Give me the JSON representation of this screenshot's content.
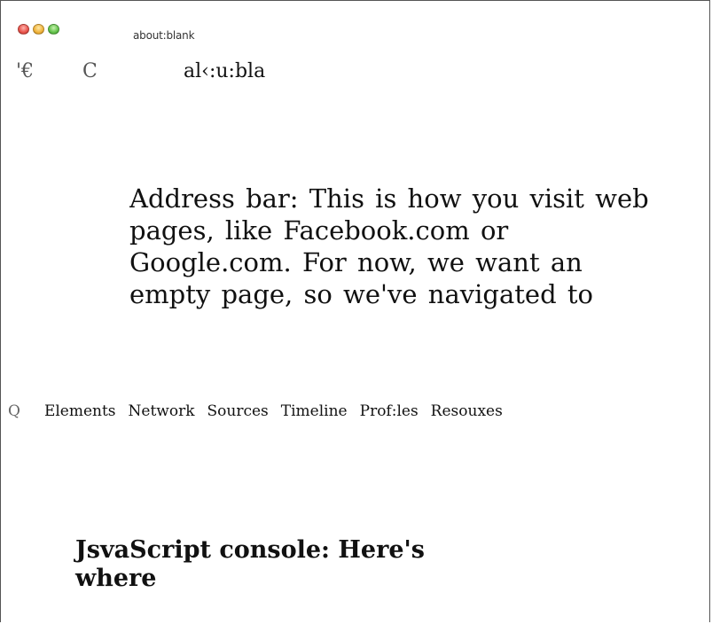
{
  "window": {
    "title": "about:blank"
  },
  "toolbar": {
    "back_glyph": "'€",
    "reload_glyph": "C",
    "address_text": "al‹:u:bla"
  },
  "annotation": {
    "address_bar_text": "Address  bar: This is how you visit web pages, like Facebook.com or Google.com. For now, we want  an empty  page,  so  we've  navigated to"
  },
  "devtools": {
    "search_glyph": "Q",
    "tabs": [
      {
        "label": "Elements"
      },
      {
        "label": "Network"
      },
      {
        "label": "Sources"
      },
      {
        "label": "Timeline"
      },
      {
        "label": "Prof:les"
      },
      {
        "label": "Resouxes"
      }
    ]
  },
  "console": {
    "caption": "JsvaScript console: Here's where"
  }
}
